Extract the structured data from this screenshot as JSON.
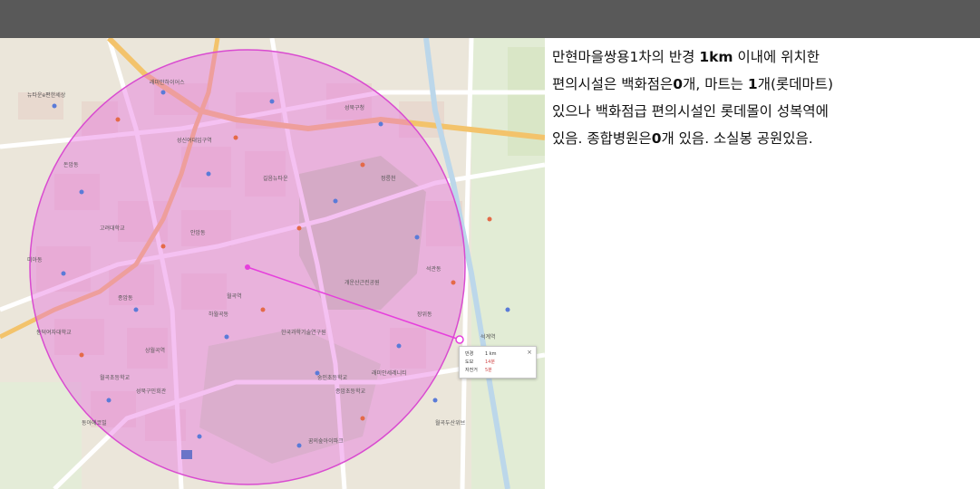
{
  "map": {
    "popup": {
      "radius_label": "반경",
      "radius_value": "1 km",
      "walk_label": "도보",
      "walk_value": "14분",
      "bike_label": "자전거",
      "bike_value": "5분",
      "close_symbol": "×"
    },
    "labels": [
      "뉴타운e편한세상",
      "래미안하이어스",
      "성북구청",
      "돈암동",
      "성신여대입구역",
      "길음뉴타운",
      "정릉천",
      "개운산근린공원",
      "고려대학교",
      "안암동",
      "미아동",
      "석관동",
      "월곡역",
      "종암동",
      "하월곡동",
      "장위동",
      "한국과학기술연구원",
      "동덕여자대학교",
      "상월곡역",
      "숭인초등학교",
      "월곡초등학교",
      "종암초등학교",
      "성북구민회관",
      "래미안세레니티",
      "월곡두산위브",
      "동아에코빌",
      "꿈의숲아이파크",
      "석계역"
    ]
  },
  "description": {
    "line1_prefix": "만현마을쌍용1차의 반경 ",
    "line1_bold": "1km",
    "line1_suffix": "  이내에 위치한",
    "line2_a": "편의시설은  백화점은",
    "line2_b": "0",
    "line2_c": "개, 마트는 ",
    "line2_d": "1",
    "line2_e": "개(롯데마트)",
    "line3": "있으나 백화점급 편의시설인 롯데몰이 성복역에",
    "line4_a": "있음. 종합병원은",
    "line4_b": "0",
    "line4_c": "개 있음. 소실봉 공원있음."
  }
}
